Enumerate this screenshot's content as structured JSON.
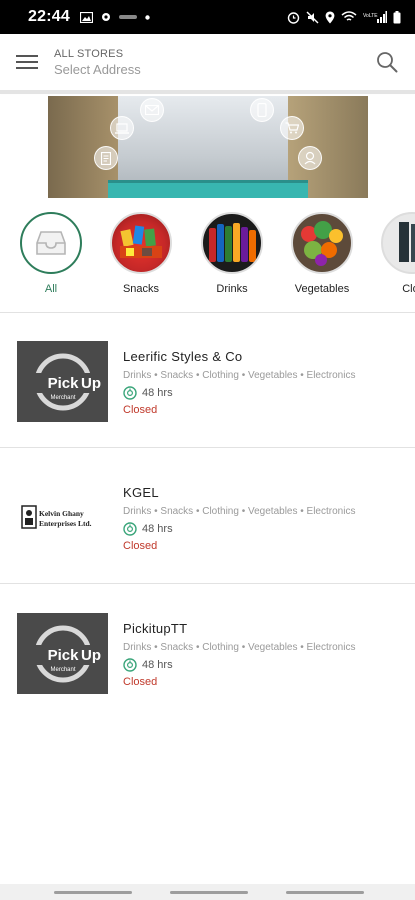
{
  "status_bar": {
    "time": "22:44",
    "left_icons": [
      "gallery-icon",
      "vpn-icon",
      "dot-icon"
    ],
    "right_icons": [
      "alarm-icon",
      "mute-icon",
      "location-icon",
      "wifi-icon",
      "signal-icon",
      "battery-icon"
    ]
  },
  "header": {
    "menu_icon": "hamburger-icon",
    "label": "ALL STORES",
    "address_placeholder": "Select Address",
    "search_icon": "search-icon"
  },
  "banner": {
    "icons": [
      "email-icon",
      "laptop-icon",
      "phone-icon",
      "cart-icon",
      "document-icon",
      "location-pin-icon"
    ]
  },
  "categories": [
    {
      "label": "All",
      "selected": true
    },
    {
      "label": "Snacks",
      "selected": false
    },
    {
      "label": "Drinks",
      "selected": false
    },
    {
      "label": "Vegetables",
      "selected": false
    },
    {
      "label": "Clot",
      "selected": false
    }
  ],
  "stores": [
    {
      "name": "Leerific Styles & Co",
      "categories": "Drinks • Snacks • Clothing • Vegetables • Electronics",
      "hours": "48 hrs",
      "status": "Closed",
      "logo_text": "Pick",
      "logo_text2": "Up",
      "logo_sub": "Merchant"
    },
    {
      "name": "KGEL",
      "categories": "Drinks • Snacks • Clothing • Vegetables • Electronics",
      "hours": "48 hrs",
      "status": "Closed",
      "logo_line1": "Kelvin Ghany",
      "logo_line2": "Enterprises Ltd."
    },
    {
      "name": "PickitupTT",
      "categories": "Drinks • Snacks • Clothing • Vegetables • Electronics",
      "hours": "48 hrs",
      "status": "Closed",
      "logo_text": "Pick",
      "logo_text2": "Up",
      "logo_sub": "Merchant"
    }
  ],
  "colors": {
    "accent": "#2e7d5b",
    "status_closed": "#c0392b",
    "logo_bg": "#4a4a4a"
  }
}
